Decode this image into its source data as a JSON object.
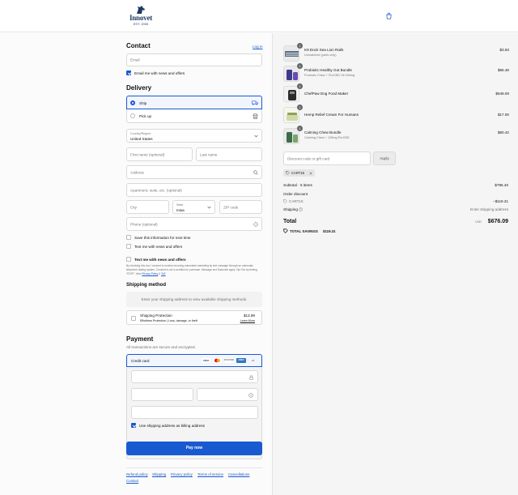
{
  "header": {
    "brand": "Innovet",
    "est": "EST. 2005"
  },
  "contact": {
    "title": "Contact",
    "login": "Log in",
    "email_placeholder": "Email",
    "email_news": "Email me with news and offers"
  },
  "delivery": {
    "title": "Delivery",
    "ship": "Ship",
    "pickup": "Pick up",
    "country_label": "Country/Region",
    "country_value": "United States",
    "first_name": "First name (optional)",
    "last_name": "Last name",
    "address": "Address",
    "apartment": "Apartment, suite, etc. (optional)",
    "city": "City",
    "state_label": "State",
    "state_value": "Iowa",
    "zip": "ZIP code",
    "phone": "Phone (optional)",
    "save_info": "Save this information for next time",
    "text_news": "Text me with news and offers",
    "text_news_bold": "Text me with news and offers",
    "legal_1": "By checking this box I consent to receive recurring automated marketing by text message through an automatic",
    "legal_2": "telephone dialing system. Consent is not a condition to purchase. Message and Data rate apply. Opt Out by texting",
    "legal_3_pre": "'STOP'. View",
    "privacy": "Privacy Policy",
    "and": "&",
    "tos": "ToS"
  },
  "shipping_method": {
    "title": "Shipping method",
    "placeholder": "Enter your shipping address to view available shipping methods.",
    "protection_title": "Shipping Protection",
    "protection_sub": "Effortless Protection | Loss, damage, or theft",
    "protection_price": "$13.99",
    "learn_more": "Learn More"
  },
  "payment": {
    "title": "Payment",
    "subtitle": "All transactions are secure and encrypted.",
    "credit_card": "Credit card",
    "card_brands": [
      "VISA",
      "MC",
      "DISCOVER",
      "AMEX",
      "+5"
    ],
    "billing_same": "Use shipping address as billing address",
    "pay_now": "Pay now"
  },
  "footer": {
    "links": [
      "Refund policy",
      "Shipping",
      "Privacy policy",
      "Terms of service",
      "Cancellations",
      "Contact"
    ]
  },
  "summary": {
    "items": [
      {
        "qty": "1",
        "name": "K9 Dock Sea Lion Rails",
        "sub": "Unmatched (parts only)",
        "price": "$3.50"
      },
      {
        "qty": "1",
        "name": "Probiotic Healthy Gut Bundle",
        "sub": "Probiotic Chew + PurCBD Oil 250mg",
        "price": "$65.48"
      },
      {
        "qty": "1",
        "name": "ChefPaw Dog Food Maker",
        "sub": "",
        "price": "$649.00"
      },
      {
        "qty": "1",
        "name": "Hemp Relief Cream For Humans",
        "sub": "",
        "price": "$17.00"
      },
      {
        "qty": "1",
        "name": "Calming Chew Bundle",
        "sub": "Calming Chew + 125mg PurCBD",
        "price": "$60.42"
      }
    ],
    "discount_placeholder": "Discount code or gift card",
    "apply": "Apply",
    "code_chip": "CART15",
    "subtotal_label": "Subtotal · 5 items",
    "subtotal_value": "$795.40",
    "order_discount_label": "Order discount",
    "discount_code": "CART15",
    "discount_value": "−$119.31",
    "shipping_label": "Shipping",
    "shipping_value": "Enter shipping address",
    "total_label": "Total",
    "currency": "USD",
    "total_value": "$676.09",
    "savings_label": "TOTAL SAVINGS",
    "savings_value": "$119.31"
  },
  "colors": {
    "accent": "#1a5ad1",
    "brand": "#1f3a5f"
  }
}
